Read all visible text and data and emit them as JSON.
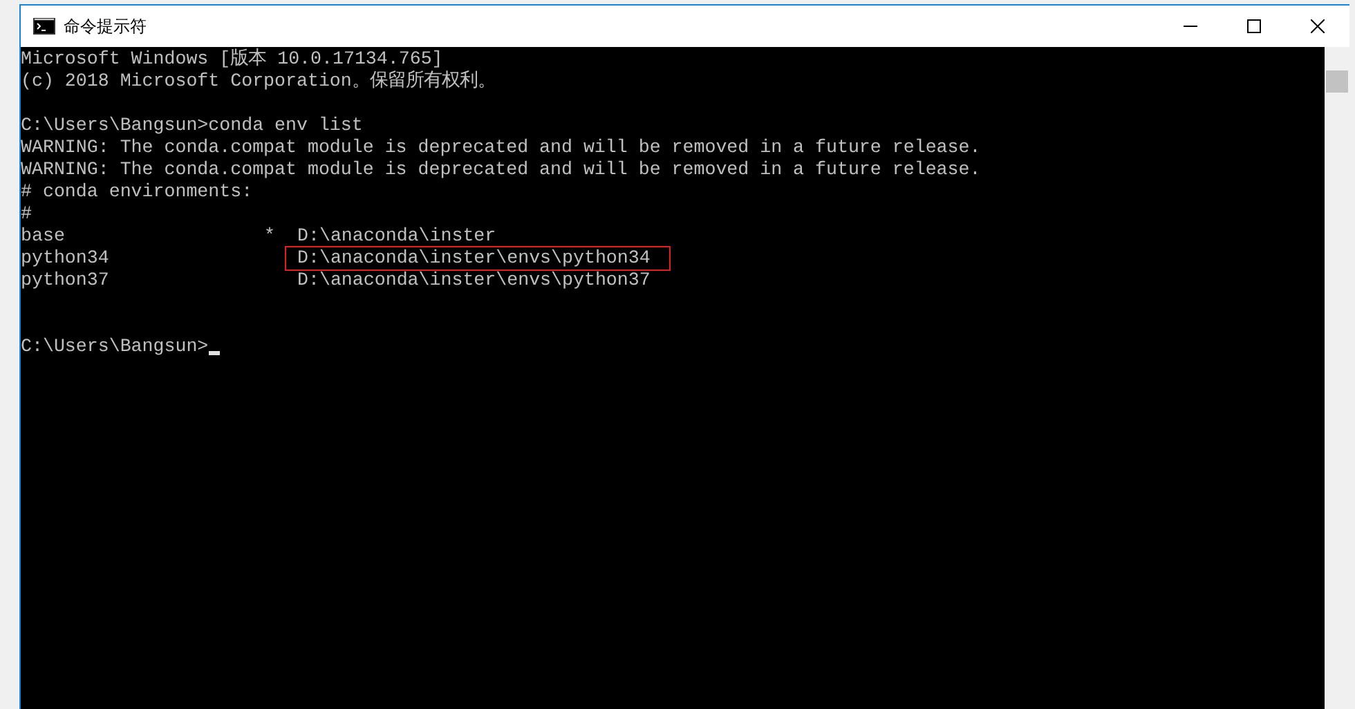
{
  "window": {
    "title": "命令提示符"
  },
  "console": {
    "lines": [
      {
        "kind": "text",
        "text": "Microsoft Windows [版本 10.0.17134.765]"
      },
      {
        "kind": "text",
        "text": "(c) 2018 Microsoft Corporation。保留所有权利。"
      },
      {
        "kind": "blank"
      },
      {
        "kind": "text",
        "text": "C:\\Users\\Bangsun>conda env list"
      },
      {
        "kind": "text",
        "text": "WARNING: The conda.compat module is deprecated and will be removed in a future release."
      },
      {
        "kind": "text",
        "text": "WARNING: The conda.compat module is deprecated and will be removed in a future release."
      },
      {
        "kind": "text",
        "text": "# conda environments:"
      },
      {
        "kind": "text",
        "text": "#"
      },
      {
        "kind": "env",
        "name": "base",
        "marker": "*",
        "path": "D:\\anaconda\\inster",
        "highlighted": false
      },
      {
        "kind": "env",
        "name": "python34",
        "path": "D:\\anaconda\\inster\\envs\\python34",
        "highlighted": true
      },
      {
        "kind": "env",
        "name": "python37",
        "path": "D:\\anaconda\\inster\\envs\\python37",
        "highlighted": false
      },
      {
        "kind": "blank"
      },
      {
        "kind": "blank"
      },
      {
        "kind": "prompt",
        "text": "C:\\Users\\Bangsun>",
        "cursor": true
      }
    ]
  }
}
